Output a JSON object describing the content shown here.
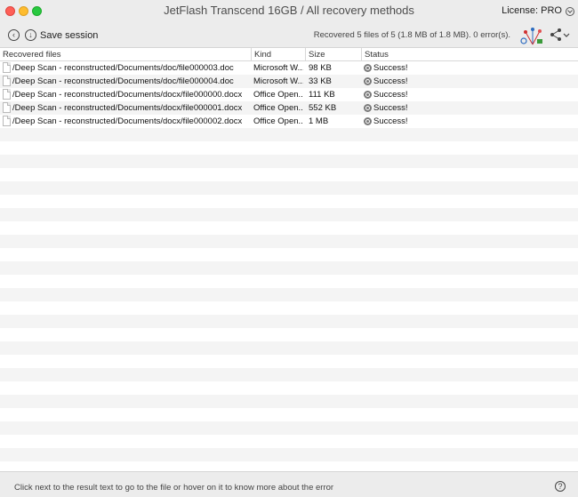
{
  "window": {
    "title": "JetFlash Transcend 16GB / All recovery methods",
    "license_label": "License: PRO",
    "license_icon": "chevron-circle-icon"
  },
  "toolbar": {
    "back_icon": "back-arrow-circle-icon",
    "save_icon": "download-circle-icon",
    "save_label": "Save session",
    "summary": "Recovered 5 files of 5 (1.8 MB of 1.8 MB). 0 error(s).",
    "celebration_icon": "fireworks-icon",
    "share_icon": "share-icon"
  },
  "table": {
    "columns": [
      "Recovered files",
      "Kind",
      "Size",
      "Status"
    ],
    "rows": [
      {
        "file": "/Deep Scan - reconstructed/Documents/doc/file000003.doc",
        "kind": "Microsoft W...",
        "size": "98 KB",
        "status": "Success!"
      },
      {
        "file": "/Deep Scan - reconstructed/Documents/doc/file000004.doc",
        "kind": "Microsoft W...",
        "size": "33 KB",
        "status": "Success!"
      },
      {
        "file": "/Deep Scan - reconstructed/Documents/docx/file000000.docx",
        "kind": "Office Open...",
        "size": "111 KB",
        "status": "Success!"
      },
      {
        "file": "/Deep Scan - reconstructed/Documents/docx/file000001.docx",
        "kind": "Office Open...",
        "size": "552 KB",
        "status": "Success!"
      },
      {
        "file": "/Deep Scan - reconstructed/Documents/docx/file000002.docx",
        "kind": "Office Open...",
        "size": "1 MB",
        "status": "Success!"
      }
    ]
  },
  "footer": {
    "hint": "Click next to the result text to go to the file or hover on it to know more about the error",
    "help_symbol": "?"
  },
  "colors": {
    "chrome": "#ececec",
    "row_alt": "#f4f4f4",
    "close": "#fe5f57",
    "minimize": "#febc2e",
    "maximize": "#28c840"
  }
}
